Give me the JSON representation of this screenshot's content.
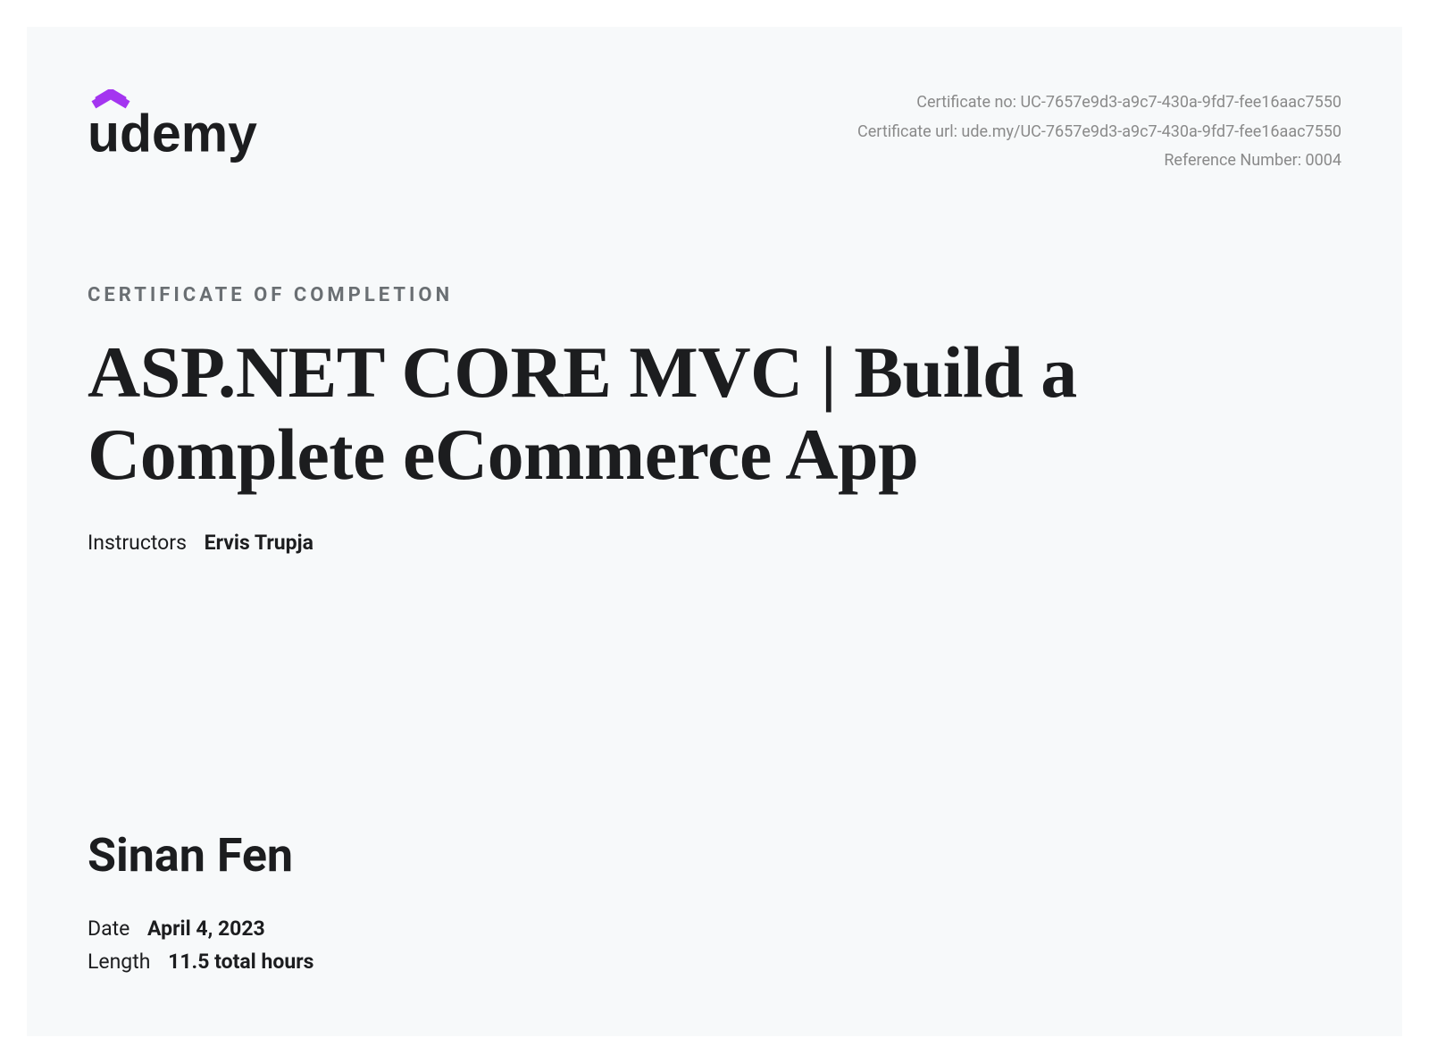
{
  "meta": {
    "certificate_no": "Certificate no: UC-7657e9d3-a9c7-430a-9fd7-fee16aac7550",
    "certificate_url": "Certificate url: ude.my/UC-7657e9d3-a9c7-430a-9fd7-fee16aac7550",
    "reference_number": "Reference Number: 0004"
  },
  "section_title": "CERTIFICATE OF COMPLETION",
  "course_title": "ASP.NET CORE MVC | Build a Complete eCommerce App",
  "instructors": {
    "label": "Instructors",
    "name": "Ervis Trupja"
  },
  "recipient": "Sinan Fen",
  "date": {
    "label": "Date",
    "value": "April 4, 2023"
  },
  "length": {
    "label": "Length",
    "value": "11.5 total hours"
  }
}
